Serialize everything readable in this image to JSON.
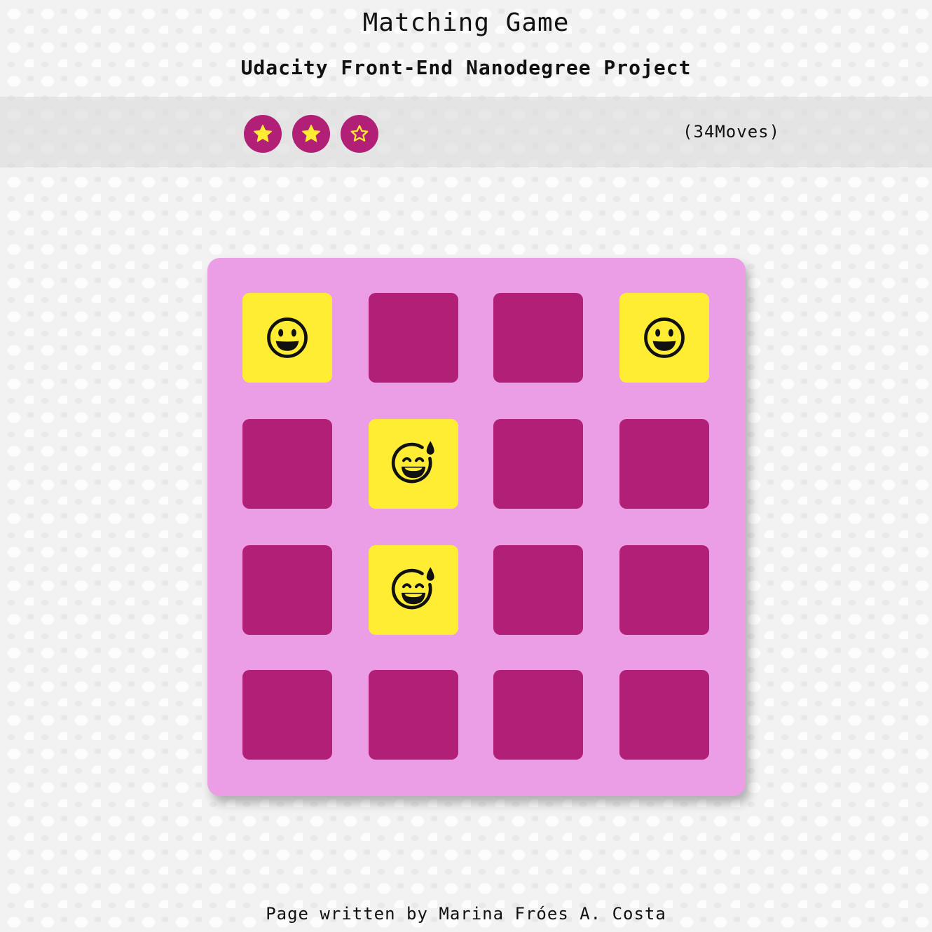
{
  "header": {
    "title": "Matching Game",
    "subtitle": "Udacity Front-End Nanodegree Project"
  },
  "score_panel": {
    "stars": [
      {
        "state": "filled",
        "icon": "star-filled-icon"
      },
      {
        "state": "filled",
        "icon": "star-filled-icon"
      },
      {
        "state": "empty",
        "icon": "star-outline-icon"
      }
    ],
    "moves_prefix": "(",
    "moves_count": "34",
    "moves_suffix": " Moves)"
  },
  "deck": {
    "rows": 4,
    "columns": 4,
    "cards": [
      {
        "state": "open",
        "symbol": "grinning-face-icon"
      },
      {
        "state": "closed",
        "symbol": ""
      },
      {
        "state": "closed",
        "symbol": ""
      },
      {
        "state": "open",
        "symbol": "grinning-face-icon"
      },
      {
        "state": "closed",
        "symbol": ""
      },
      {
        "state": "open",
        "symbol": "grinning-sweat-face-icon"
      },
      {
        "state": "closed",
        "symbol": ""
      },
      {
        "state": "closed",
        "symbol": ""
      },
      {
        "state": "closed",
        "symbol": ""
      },
      {
        "state": "open",
        "symbol": "grinning-sweat-face-icon"
      },
      {
        "state": "closed",
        "symbol": ""
      },
      {
        "state": "closed",
        "symbol": ""
      },
      {
        "state": "closed",
        "symbol": ""
      },
      {
        "state": "closed",
        "symbol": ""
      },
      {
        "state": "closed",
        "symbol": ""
      },
      {
        "state": "closed",
        "symbol": ""
      }
    ]
  },
  "footer": {
    "text": "Page written by Marina Fróes A. Costa"
  },
  "colors": {
    "card_back": "#b11f76",
    "card_open": "#ffed33",
    "deck_background": "#eb9ee6",
    "star_background": "#b11f76",
    "star_fill": "#ffed33"
  }
}
